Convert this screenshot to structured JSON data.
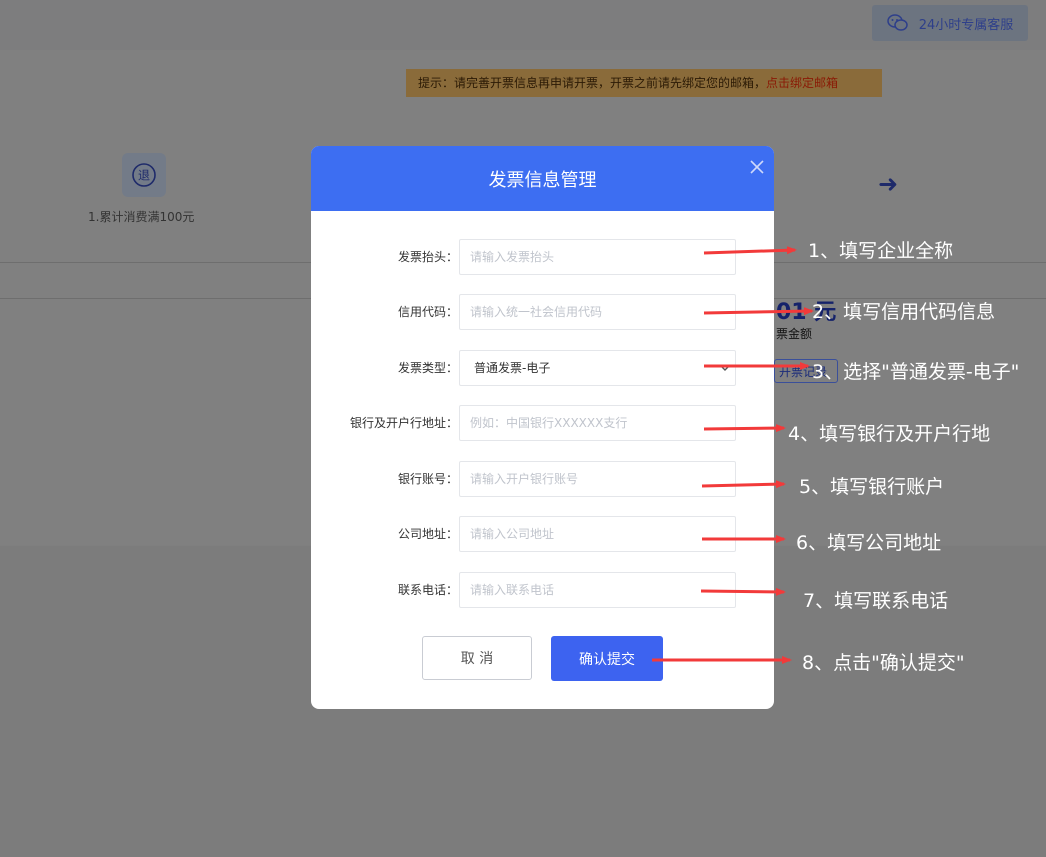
{
  "header": {
    "service_button": "24小时专属客服",
    "service_icon": "wechat-icon"
  },
  "tip": {
    "text": "提示：请完善开票信息再申请开票，开票之前请先绑定您的邮箱，",
    "link": "点击绑定邮箱"
  },
  "background": {
    "step1_icon_char": "退",
    "step1_label": "1.累计消费满100元",
    "arrow": "➜",
    "amount": "01 元",
    "amount_label": "票金额",
    "record_button": "开票记录"
  },
  "modal": {
    "title": "发票信息管理",
    "fields": [
      {
        "label": "发票抬头：",
        "placeholder": "请输入发票抬头"
      },
      {
        "label": "信用代码：",
        "placeholder": "请输入统一社会信用代码"
      },
      {
        "label": "发票类型：",
        "value": "普通发票-电子"
      },
      {
        "label": "银行及开户行地址：",
        "placeholder": "例如：中国银行XXXXXX支行"
      },
      {
        "label": "银行账号：",
        "placeholder": "请输入开户银行账号"
      },
      {
        "label": "公司地址：",
        "placeholder": "请输入公司地址"
      },
      {
        "label": "联系电话：",
        "placeholder": "请输入联系电话"
      }
    ],
    "cancel_label": "取 消",
    "submit_label": "确认提交"
  },
  "annotations": [
    "1、填写企业全称",
    "2、填写信用代码信息",
    "3、选择\"普通发票-电子\"",
    "4、填写银行及开户行地",
    "5、填写银行账户",
    "6、填写公司地址",
    "7、填写联系电话",
    "8、点击\"确认提交\""
  ],
  "colors": {
    "primary": "#3d6ef2",
    "arrow_red": "#f23a3a",
    "overlay": "#808080"
  }
}
